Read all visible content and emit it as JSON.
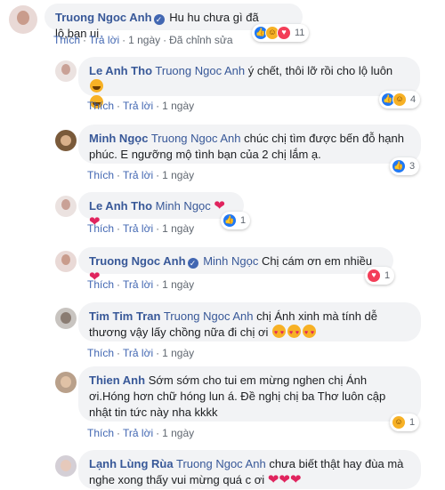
{
  "actions": {
    "like": "Thích",
    "reply": "Trả lời",
    "edited": "Đã chỉnh sửa"
  },
  "comments": [
    {
      "author": "Truong Ngoc Anh",
      "text": "Hu hu chưa gì đã lộ,bạn ui",
      "time": "1 ngày",
      "reaction_count": "11"
    },
    {
      "author": "Le Anh Tho",
      "mention": "Truong Ngoc Anh",
      "text_line1": " ý chết, thôi lỡ rồi cho lộ luôn",
      "time": "1 ngày",
      "reaction_count": "4"
    },
    {
      "author": "Minh Ngọc",
      "mention": "Truong Ngoc Anh",
      "text": " chúc chị tìm được bến đỗ hạnh phúc. E ngưỡng mộ tình bạn của 2 chị lắm ạ.",
      "time": "1 ngày",
      "reaction_count": "3"
    },
    {
      "author": "Le Anh Tho",
      "mention": "Minh Ngọc",
      "time": "1 ngày",
      "reaction_count": "1"
    },
    {
      "author": "Truong Ngoc Anh",
      "mention": "Minh Ngọc",
      "text": " Chị cám ơn em nhiều",
      "time": "1 ngày",
      "reaction_count": "1"
    },
    {
      "author": "Tim Tim Tran",
      "mention": "Truong Ngoc Anh",
      "text": " chị Ánh xinh mà tính dễ thương vậy lấy chồng nữa đi chị ơi",
      "time": "1 ngày"
    },
    {
      "author": "Thien Anh",
      "text": " Sớm sớm cho tui em mừng nghen chị Ánh ơi.Hóng hơn chữ hóng lun á. Đề nghị chị ba Thơ luôn cập nhật tin tức này nha kkkk",
      "time": "1 ngày",
      "reaction_count": "1"
    },
    {
      "author": "Lạnh Lùng Rùa",
      "mention": "Truong Ngoc Anh",
      "text": " chưa biết thật hay đùa mà nghe xong thấy vui mừng quá c ơi"
    }
  ],
  "colors": {
    "link": "#385898",
    "bubble": "#f2f3f5",
    "like": "#2078f4",
    "love": "#f33e58",
    "haha": "#f7b125"
  }
}
